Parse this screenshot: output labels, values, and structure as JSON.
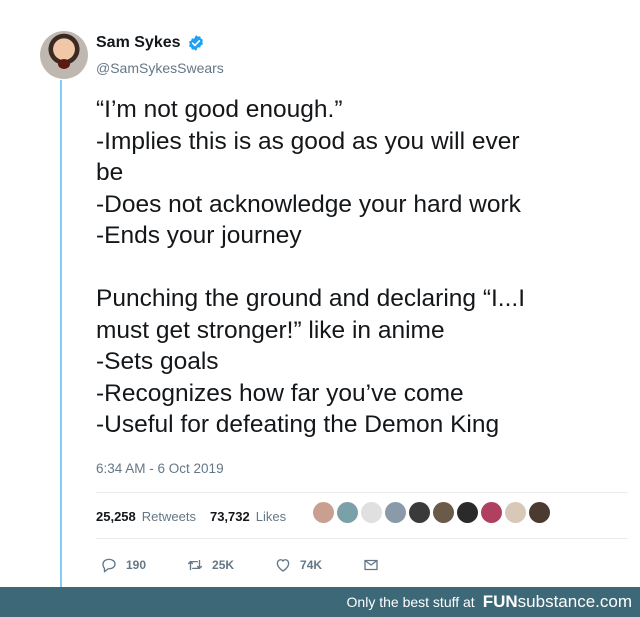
{
  "tweet": {
    "author_name": "Sam Sykes",
    "handle": "@SamSykesSwears",
    "lines": [
      "“I’m not good enough.”",
      "-Implies this is as good as you will ever",
      "be",
      "-Does not acknowledge your hard work",
      "-Ends your journey",
      "",
      "Punching the ground and declaring “I...I",
      "must get stronger!” like in anime",
      "-Sets goals",
      "-Recognizes how far you’ve come",
      "-Useful for defeating the Demon King"
    ],
    "timestamp": "6:34 AM - 6 Oct 2019",
    "retweets_count": "25,258",
    "retweets_label": "Retweets",
    "likes_count": "73,732",
    "likes_label": "Likes",
    "actions": {
      "reply_count": "190",
      "retweet_count": "25K",
      "like_count": "74K"
    },
    "liker_avatar_colors": [
      "#c9a090",
      "#7aa0a8",
      "#e0e0e0",
      "#8a9aa8",
      "#3a3a3a",
      "#6a5a4a",
      "#2a2a2a",
      "#b04060",
      "#d8c8b8",
      "#4a3a30"
    ],
    "verified_color": "#1da1f2"
  },
  "footer": {
    "tagline": "Only the best stuff at",
    "brand_bold": "FUN",
    "brand_rest": "substance",
    "brand_suffix": ".com"
  },
  "icons": [
    "verified-badge-icon",
    "reply-icon",
    "retweet-icon",
    "like-icon",
    "share-icon"
  ]
}
